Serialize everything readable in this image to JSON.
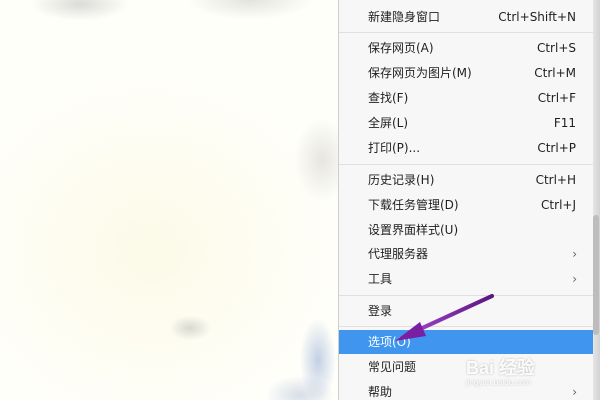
{
  "menu": {
    "items": [
      {
        "label": "新建隐身窗口",
        "shortcut": "Ctrl+Shift+N"
      },
      {
        "label": "保存网页(A)",
        "shortcut": "Ctrl+S"
      },
      {
        "label": "保存网页为图片(M)",
        "shortcut": "Ctrl+M"
      },
      {
        "label": "查找(F)",
        "shortcut": "Ctrl+F"
      },
      {
        "label": "全屏(L)",
        "shortcut": "F11"
      },
      {
        "label": "打印(P)...",
        "shortcut": "Ctrl+P"
      },
      {
        "label": "历史记录(H)",
        "shortcut": "Ctrl+H"
      },
      {
        "label": "下载任务管理(D)",
        "shortcut": "Ctrl+J"
      },
      {
        "label": "设置界面样式(U)",
        "shortcut": ""
      },
      {
        "label": "代理服务器",
        "shortcut": "",
        "submenu": true
      },
      {
        "label": "工具",
        "shortcut": "",
        "submenu": true
      },
      {
        "label": "登录",
        "shortcut": ""
      },
      {
        "label": "选项(O)",
        "shortcut": "",
        "highlighted": true
      },
      {
        "label": "常见问题",
        "shortcut": ""
      },
      {
        "label": "帮助",
        "shortcut": "",
        "submenu": true
      }
    ],
    "submenu_glyph": "›",
    "highlight_color": "#4096ee"
  },
  "annotation": {
    "arrow_color": "#7a1fa2",
    "points_to": "选项(O)"
  },
  "watermark": {
    "text": "Bai 经验",
    "subtext": "jingyan.baidu.com"
  }
}
